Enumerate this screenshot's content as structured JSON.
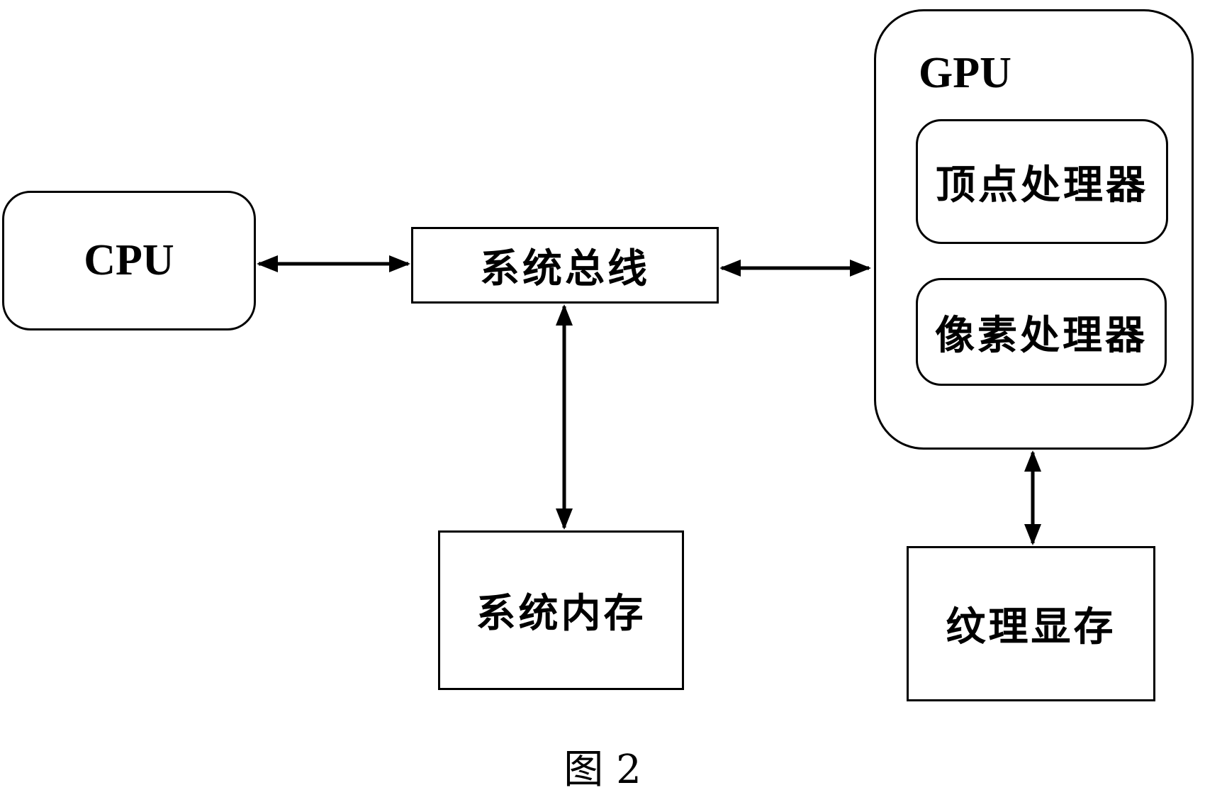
{
  "diagram": {
    "nodes": {
      "cpu": "CPU",
      "system_bus": "系统总线",
      "system_memory": "系统内存",
      "gpu": "GPU",
      "vertex_processor": "顶点处理器",
      "pixel_processor": "像素处理器",
      "texture_memory": "纹理显存"
    },
    "edges": [
      {
        "from": "cpu",
        "to": "system_bus",
        "direction": "bidirectional"
      },
      {
        "from": "system_bus",
        "to": "gpu",
        "direction": "bidirectional"
      },
      {
        "from": "system_bus",
        "to": "system_memory",
        "direction": "bidirectional"
      },
      {
        "from": "gpu",
        "to": "texture_memory",
        "direction": "bidirectional"
      }
    ],
    "caption": "图 2"
  }
}
